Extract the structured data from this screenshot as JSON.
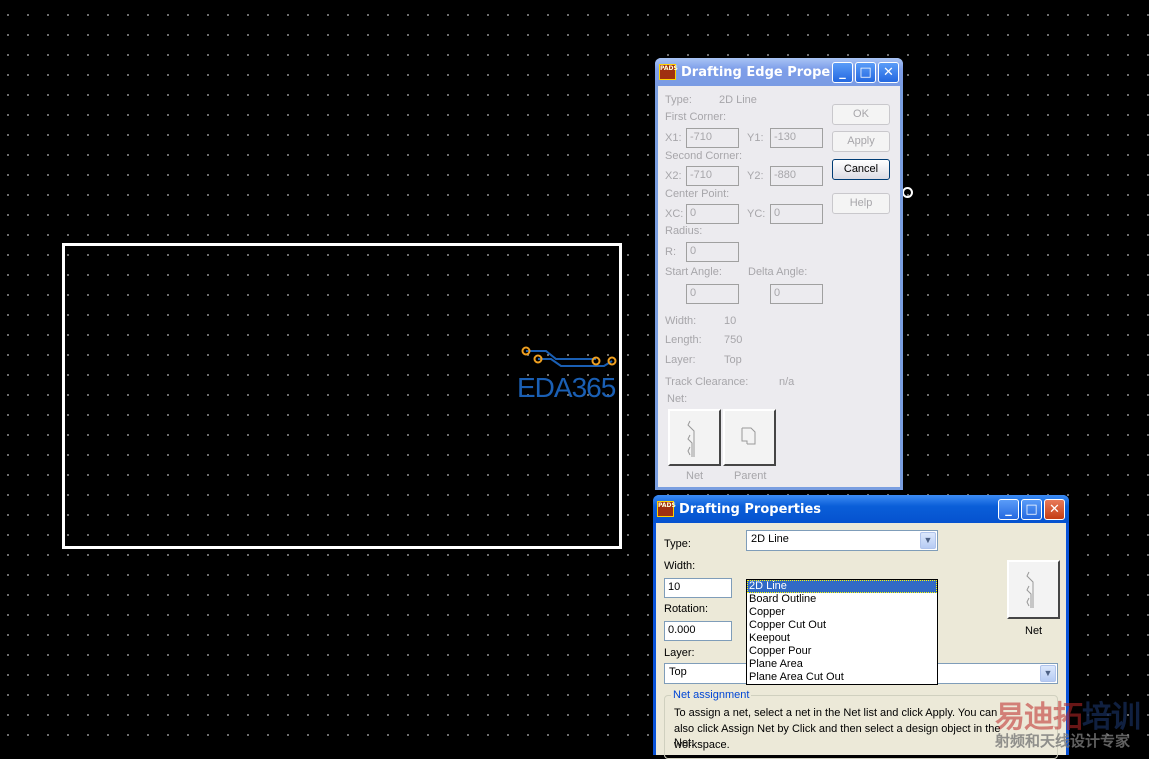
{
  "canvas": {
    "logo": "EDA365",
    "watermark_line1a": "易迪拓",
    "watermark_line1b": "培训",
    "watermark_line2": "射频和天线设计专家"
  },
  "edge_dialog": {
    "title": "Drafting Edge Proper...",
    "type_label": "Type:",
    "type_value": "2D Line",
    "first_corner": "First Corner:",
    "x1_label": "X1:",
    "x1": "-710",
    "y1_label": "Y1:",
    "y1": "-130",
    "second_corner": "Second Corner:",
    "x2_label": "X2:",
    "x2": "-710",
    "y2_label": "Y2:",
    "y2": "-880",
    "center_point": "Center Point:",
    "xc_label": "XC:",
    "xc": "0",
    "yc_label": "YC:",
    "yc": "0",
    "radius": "Radius:",
    "r_label": "R:",
    "r": "0",
    "start_angle_label": "Start Angle:",
    "start_angle": "0",
    "delta_angle_label": "Delta Angle:",
    "delta_angle": "0",
    "width_label": "Width:",
    "width": "10",
    "length_label": "Length:",
    "length": "750",
    "layer_label": "Layer:",
    "layer": "Top",
    "track_clearance_label": "Track Clearance:",
    "track_clearance": "n/a",
    "net_label": "Net:",
    "ok": "OK",
    "apply": "Apply",
    "cancel": "Cancel",
    "help": "Help",
    "net_button": "Net",
    "parent_button": "Parent"
  },
  "props_dialog": {
    "title": "Drafting Properties",
    "type_label": "Type:",
    "type_value": "2D Line",
    "type_options": [
      "2D Line",
      "Board Outline",
      "Copper",
      "Copper Cut Out",
      "Keepout",
      "Copper Pour",
      "Plane Area",
      "Plane Area Cut Out"
    ],
    "width_label": "Width:",
    "width": "10",
    "rotation_label": "Rotation:",
    "rotation": "0.000",
    "layer_label": "Layer:",
    "layer": "Top",
    "net_button": "Net",
    "net_assignment": "Net assignment",
    "net_help": "To assign a net, select a net in the Net list and click Apply. You can also click Assign Net by Click and then select a design object in the workspace.",
    "net_label": "Net:"
  }
}
